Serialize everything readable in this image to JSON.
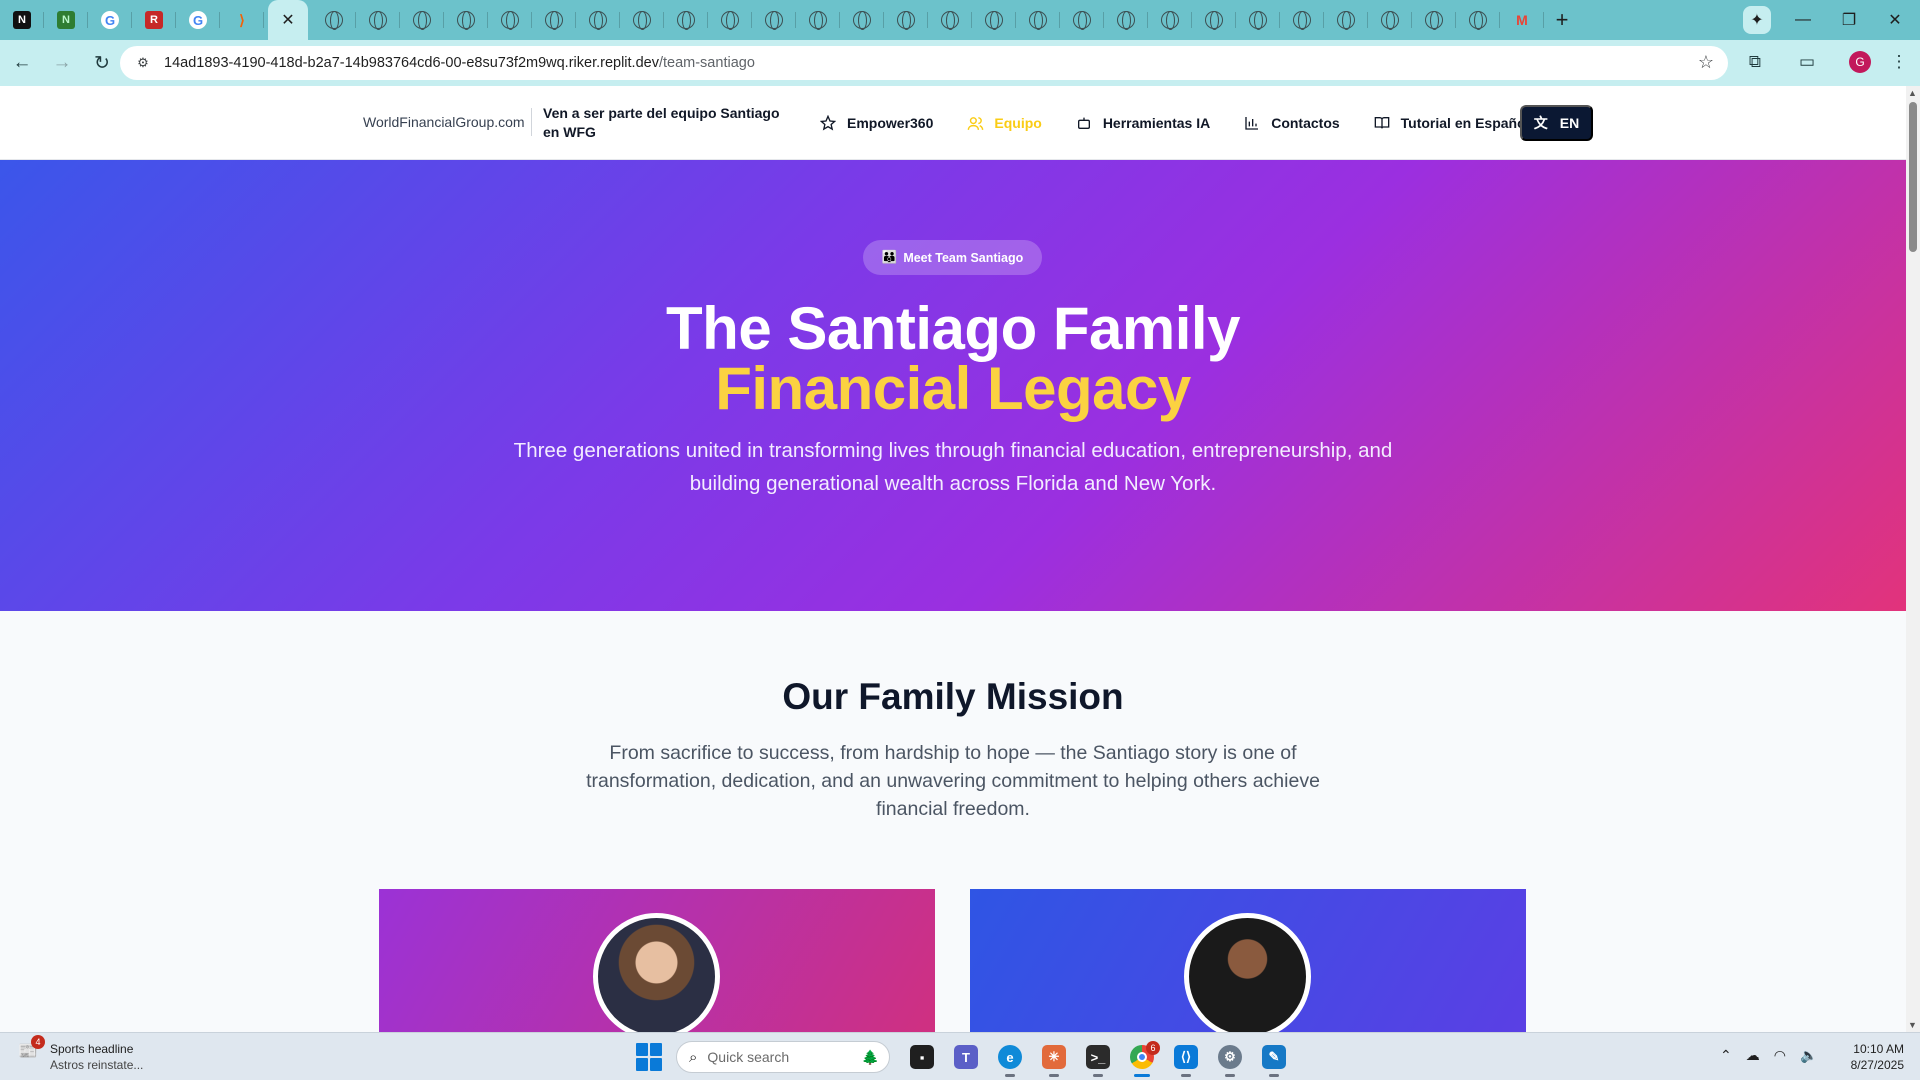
{
  "browser": {
    "active_tab_close": "✕",
    "url_host": "14ad1893-4190-418d-b2a7-14b983764cd6-00-e8su73f2m9wq.riker.replit.dev",
    "url_path": "/team-santiago",
    "profile_initial": "G",
    "colors": {
      "tabstrip": "#6cc2cb",
      "toolbar": "#c6eef0"
    }
  },
  "site": {
    "brand": "WorldFinancialGroup.com",
    "tagline": "Ven a ser parte del equipo Santiago en WFG",
    "nav": [
      {
        "label": "Empower360",
        "icon": "star-icon"
      },
      {
        "label": "Equipo",
        "icon": "users-icon",
        "active": true
      },
      {
        "label": "Herramientas IA",
        "icon": "bot-icon"
      },
      {
        "label": "Contactos",
        "icon": "bar-chart-icon"
      },
      {
        "label": "Tutorial en Español",
        "icon": "book-icon"
      }
    ],
    "language_button": "EN"
  },
  "hero": {
    "pill": "Meet Team Santiago",
    "title_line1": "The Santiago Family",
    "title_line2": "Financial Legacy",
    "subtitle": "Three generations united in transforming lives through financial education, entrepreneurship, and building generational wealth across Florida and New York.",
    "colors": {
      "accent": "#fbd241",
      "gradient_start": "#3b56ea",
      "gradient_end": "#e2337b"
    }
  },
  "mission": {
    "title": "Our Family Mission",
    "text": "From sacrifice to success, from hardship to hope — the Santiago story is one of transformation, dedication, and an unwavering commitment to helping others achieve financial freedom."
  },
  "taskbar": {
    "news_badge": "4",
    "news_title": "Sports headline",
    "news_sub": "Astros reinstate...",
    "search_placeholder": "Quick search",
    "chrome_badge": "6",
    "time": "10:10 AM",
    "date": "8/27/2025"
  }
}
